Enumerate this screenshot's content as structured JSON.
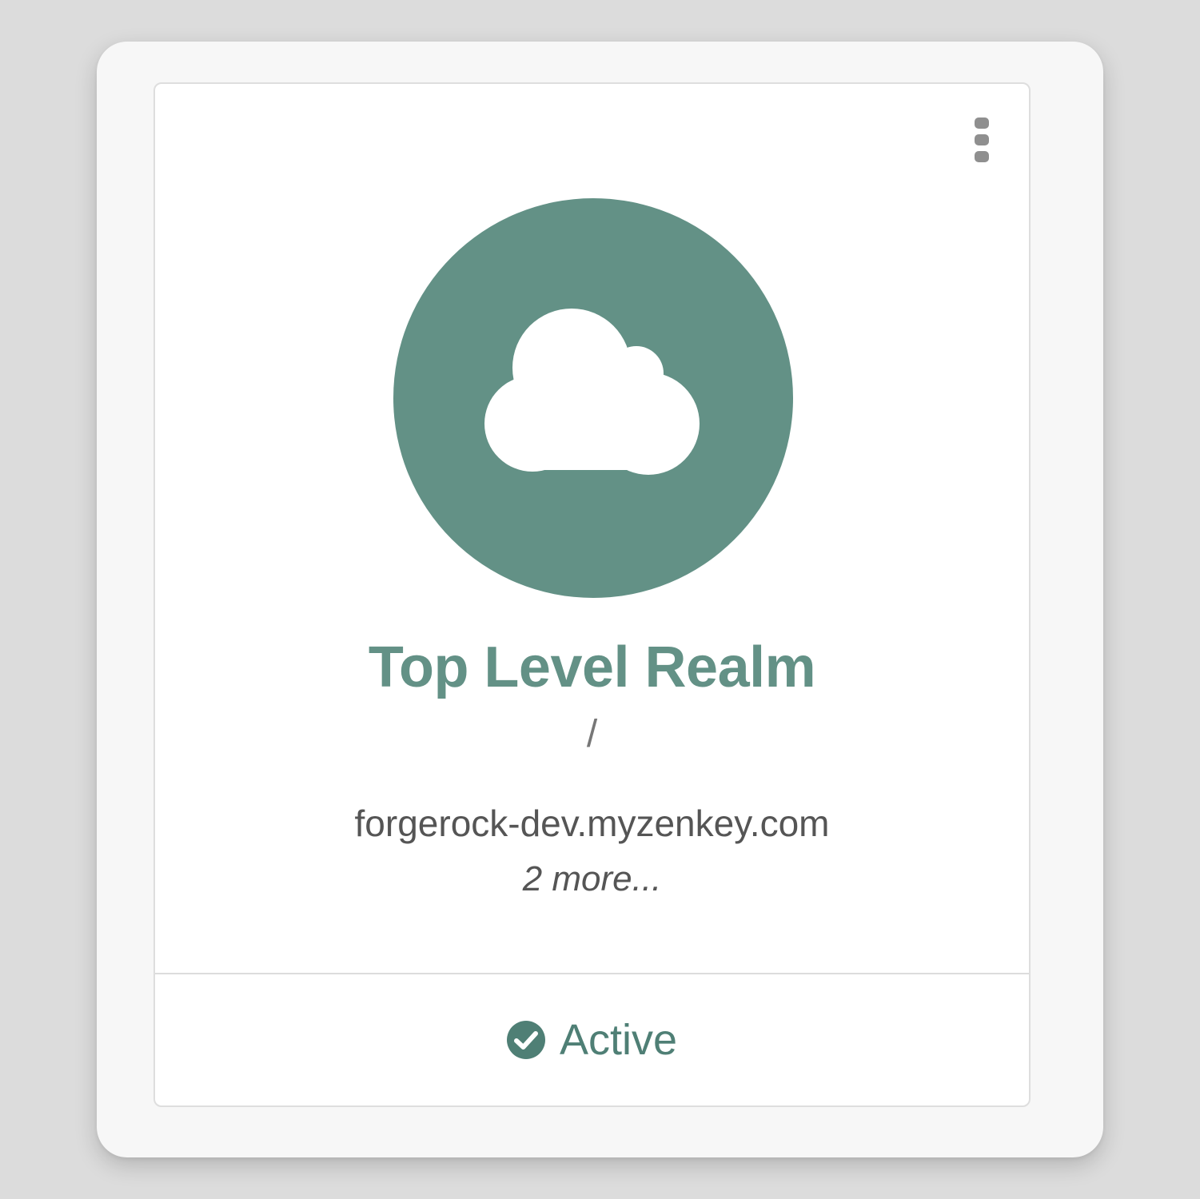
{
  "realm_card": {
    "name": "Top Level Realm",
    "path": "/",
    "alias": "forgerock-dev.myzenkey.com",
    "more_aliases": "2 more...",
    "status": "Active",
    "icon": "cloud-icon",
    "status_icon": "check-circle-icon",
    "menu_icon": "kebab-menu-icon"
  },
  "colors": {
    "accent": "#639186",
    "status": "#4f7f75",
    "background": "#dcdcdc"
  }
}
